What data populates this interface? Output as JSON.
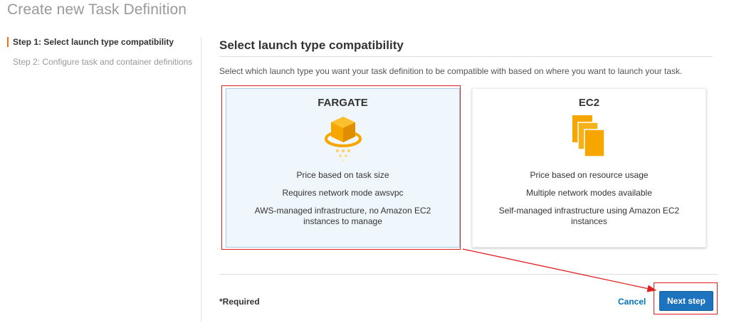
{
  "page": {
    "title": "Create new Task Definition"
  },
  "steps": [
    {
      "label": "Step 1: Select launch type compatibility",
      "active": true
    },
    {
      "label": "Step 2: Configure task and container definitions",
      "active": false
    }
  ],
  "section": {
    "title": "Select launch type compatibility",
    "description": "Select which launch type you want your task definition to be compatible with based on where you want to launch your task."
  },
  "cards": {
    "fargate": {
      "title": "FARGATE",
      "icon": "fargate-icon",
      "lines": [
        "Price based on task size",
        "Requires network mode awsvpc",
        "AWS-managed infrastructure, no Amazon EC2 instances to manage"
      ],
      "selected": true
    },
    "ec2": {
      "title": "EC2",
      "icon": "ec2-icon",
      "lines": [
        "Price based on resource usage",
        "Multiple network modes available",
        "Self-managed infrastructure using Amazon EC2 instances"
      ],
      "selected": false
    }
  },
  "footer": {
    "required": "*Required",
    "cancel": "Cancel",
    "next": "Next step"
  },
  "colors": {
    "accent": "#ec7211",
    "primary_button": "#1e73be",
    "link": "#0073bb",
    "annotation": "#e02020",
    "icon_orange": "#f7a600"
  }
}
